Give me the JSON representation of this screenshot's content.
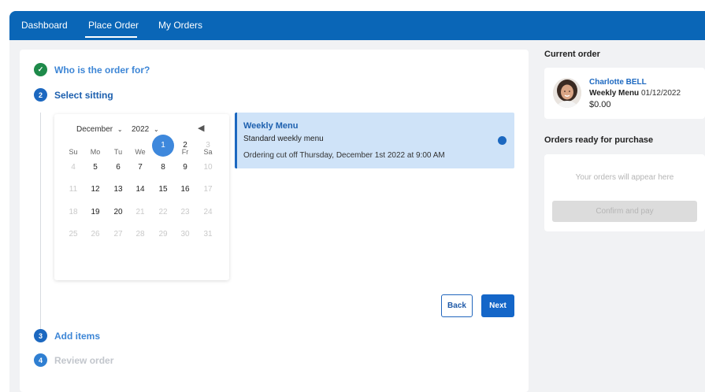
{
  "nav": {
    "items": [
      {
        "label": "Dashboard"
      },
      {
        "label": "Place Order"
      },
      {
        "label": "My Orders"
      }
    ],
    "active": "Place Order"
  },
  "steps": [
    {
      "number": "✓",
      "label": "Who is the order for?",
      "state": "complete"
    },
    {
      "number": "2",
      "label": "Select sitting",
      "state": "active"
    },
    {
      "number": "3",
      "label": "Add items",
      "state": "upcoming"
    },
    {
      "number": "4",
      "label": "Review order",
      "state": "disabled"
    }
  ],
  "calendar": {
    "month": "December",
    "year": "2022",
    "weekdays": [
      "Su",
      "Mo",
      "Tu",
      "We",
      "Th",
      "Fr",
      "Sa"
    ],
    "weeks": [
      [
        "",
        "",
        "",
        "",
        "1",
        "2",
        "3"
      ],
      [
        "4",
        "5",
        "6",
        "7",
        "8",
        "9",
        "10"
      ],
      [
        "11",
        "12",
        "13",
        "14",
        "15",
        "16",
        "17"
      ],
      [
        "18",
        "19",
        "20",
        "21",
        "22",
        "23",
        "24"
      ],
      [
        "25",
        "26",
        "27",
        "28",
        "29",
        "30",
        "31"
      ]
    ],
    "selected_day": "1",
    "available_days": [
      "1",
      "2",
      "5",
      "6",
      "7",
      "8",
      "9",
      "12",
      "13",
      "14",
      "15",
      "16",
      "19",
      "20"
    ]
  },
  "menu": {
    "title": "Weekly Menu",
    "subtitle": "Standard weekly menu",
    "cutoff": "Ordering cut off Thursday, December 1st 2022 at 9:00 AM"
  },
  "actions": {
    "back": "Back",
    "next": "Next"
  },
  "current_order": {
    "heading": "Current order",
    "name": "Charlotte BELL",
    "menu": "Weekly Menu",
    "date": "01/12/2022",
    "price": "$0.00"
  },
  "ready": {
    "heading": "Orders ready for purchase",
    "empty": "Your orders will appear here",
    "confirm": "Confirm and pay"
  },
  "colors": {
    "brand": "#0a66b7",
    "accent": "#1466c8",
    "success": "#1e8a4a",
    "selected_bg": "#cfe3f8"
  }
}
